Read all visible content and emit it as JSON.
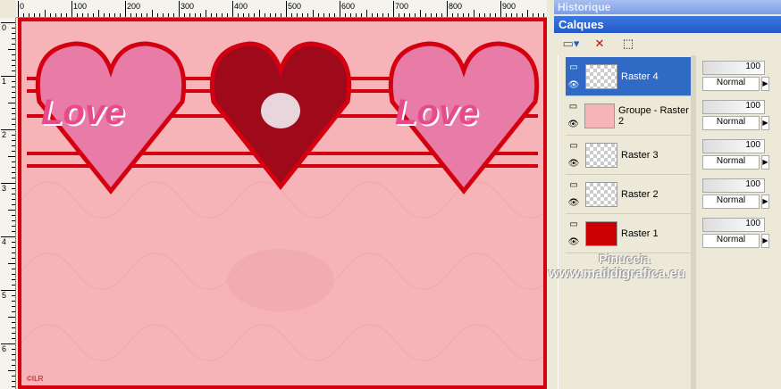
{
  "rulers": {
    "h": [
      "0",
      "100",
      "200",
      "300",
      "400",
      "500",
      "600",
      "700",
      "800",
      "900"
    ],
    "v": [
      "0",
      "1",
      "2",
      "3",
      "4",
      "5",
      "6"
    ]
  },
  "canvas": {
    "background": "#f6b4b9",
    "border": "#d40010",
    "heart_text": "Love",
    "copyright": "©ILR"
  },
  "panels": {
    "history_title": "Historique",
    "layers_title": "Calques"
  },
  "toolbar": {
    "new_layer": "new-layer-icon",
    "delete_layer": "delete-layer-icon",
    "edit_selection": "edit-selection-icon"
  },
  "layers": [
    {
      "name": "Raster 4",
      "opacity": "100",
      "blend": "Normal",
      "selected": true
    },
    {
      "name": "Groupe - Raster 2",
      "opacity": "100",
      "blend": "Normal",
      "selected": false
    },
    {
      "name": "Raster 3",
      "opacity": "100",
      "blend": "Normal",
      "selected": false
    },
    {
      "name": "Raster 2",
      "opacity": "100",
      "blend": "Normal",
      "selected": false
    },
    {
      "name": "Raster 1",
      "opacity": "100",
      "blend": "Normal",
      "selected": false
    }
  ],
  "watermark": {
    "line1": "Pinuccia",
    "line2": "www.maildigrafica.eu"
  }
}
